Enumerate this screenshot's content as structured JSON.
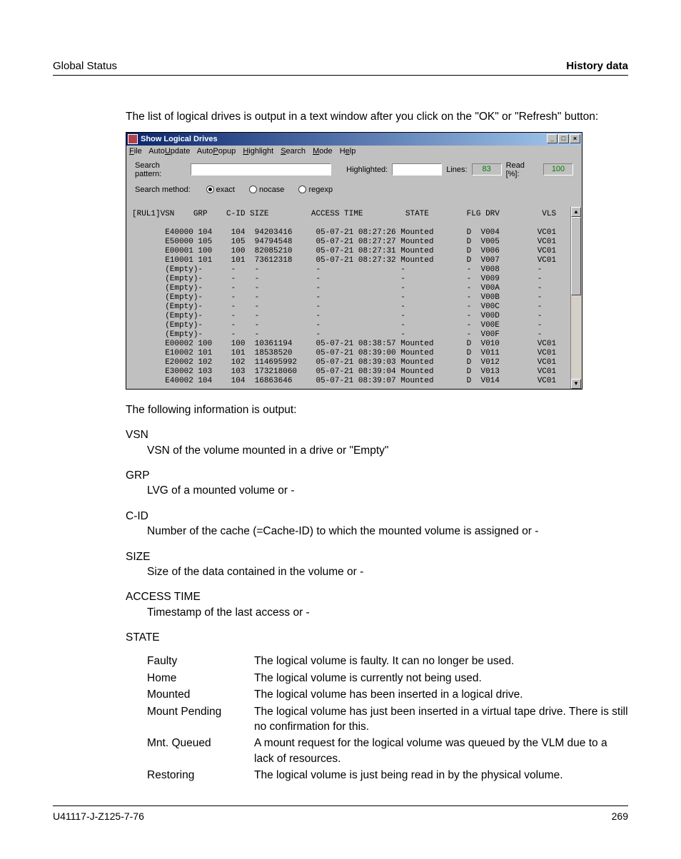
{
  "header": {
    "left": "Global Status",
    "right": "History data"
  },
  "intro": "The list of logical drives is output in a text window after you click on the \"OK\" or \"Refresh\" button:",
  "window": {
    "title": "Show Logical Drives",
    "btns": {
      "min": "_",
      "max": "□",
      "close": "×"
    },
    "menu": [
      "File",
      "AutoUpdate",
      "AutoPopup",
      "Highlight",
      "Search",
      "Mode",
      "Help"
    ],
    "toolbar": {
      "search_pattern_label": "Search pattern:",
      "highlighted_label": "Highlighted:",
      "lines_label": "Lines:",
      "lines_value": "83",
      "read_label": "Read [%]:",
      "read_value": "100",
      "method_label": "Search method:",
      "radios": [
        {
          "label": "exact",
          "selected": true
        },
        {
          "label": "nocase",
          "selected": false
        },
        {
          "label": "regexp",
          "selected": false
        }
      ]
    },
    "columns": "[RUL1]VSN    GRP    C-ID SIZE         ACCESS TIME         STATE        FLG DRV         VLS",
    "rows": [
      "       E40000 104    104  94203416     05-07-21 08:27:26 Mounted       D  V004        VC01",
      "       E50000 105    105  94794548     05-07-21 08:27:27 Mounted       D  V005        VC01",
      "       E00001 100    100  82085210     05-07-21 08:27:31 Mounted       D  V006        VC01",
      "       E10001 101    101  73612318     05-07-21 08:27:32 Mounted       D  V007        VC01",
      "       (Empty)-      -    -            -                 -             -  V008        -",
      "       (Empty)-      -    -            -                 -             -  V009        -",
      "       (Empty)-      -    -            -                 -             -  V00A        -",
      "       (Empty)-      -    -            -                 -             -  V00B        -",
      "       (Empty)-      -    -            -                 -             -  V00C        -",
      "       (Empty)-      -    -            -                 -             -  V00D        -",
      "       (Empty)-      -    -            -                 -             -  V00E        -",
      "       (Empty)-      -    -            -                 -             -  V00F        -",
      "       E00002 100    100  10361194     05-07-21 08:38:57 Mounted       D  V010        VC01",
      "       E10002 101    101  18538520     05-07-21 08:39:00 Mounted       D  V011        VC01",
      "       E20002 102    102  114695992    05-07-21 08:39:03 Mounted       D  V012        VC01",
      "       E30002 103    103  173218060    05-07-21 08:39:04 Mounted       D  V013        VC01",
      "       E40002 104    104  16863646     05-07-21 08:39:07 Mounted       D  V014        VC01"
    ]
  },
  "lead_out": "The following information is output:",
  "defs": [
    {
      "term": "VSN",
      "desc": "VSN of the volume mounted in a drive or \"Empty\""
    },
    {
      "term": "GRP",
      "desc": "LVG of a mounted volume or -"
    },
    {
      "term": "C-ID",
      "desc": "Number of the cache (=Cache-ID) to which the mounted volume is assigned or -"
    },
    {
      "term": "SIZE",
      "desc": "Size of the data contained in the volume or -"
    },
    {
      "term": "ACCESS TIME",
      "desc": "Timestamp of the last access or -"
    },
    {
      "term": "STATE",
      "desc": ""
    }
  ],
  "states": [
    {
      "label": "Faulty",
      "desc": "The logical volume is faulty. It can no longer be used."
    },
    {
      "label": "Home",
      "desc": "The logical volume is currently not being used."
    },
    {
      "label": "Mounted",
      "desc": "The logical volume has been inserted in a logical drive."
    },
    {
      "label": "Mount Pending",
      "desc": "The logical volume has just been inserted in a virtual tape drive. There is still no confirmation for this."
    },
    {
      "label": "Mnt. Queued",
      "desc": "A mount request for the logical volume was queued by the VLM due to a lack of resources."
    },
    {
      "label": "Restoring",
      "desc": "The logical volume is just being read in by the physical volume."
    }
  ],
  "footer": {
    "id": "U41117-J-Z125-7-76",
    "page": "269"
  }
}
